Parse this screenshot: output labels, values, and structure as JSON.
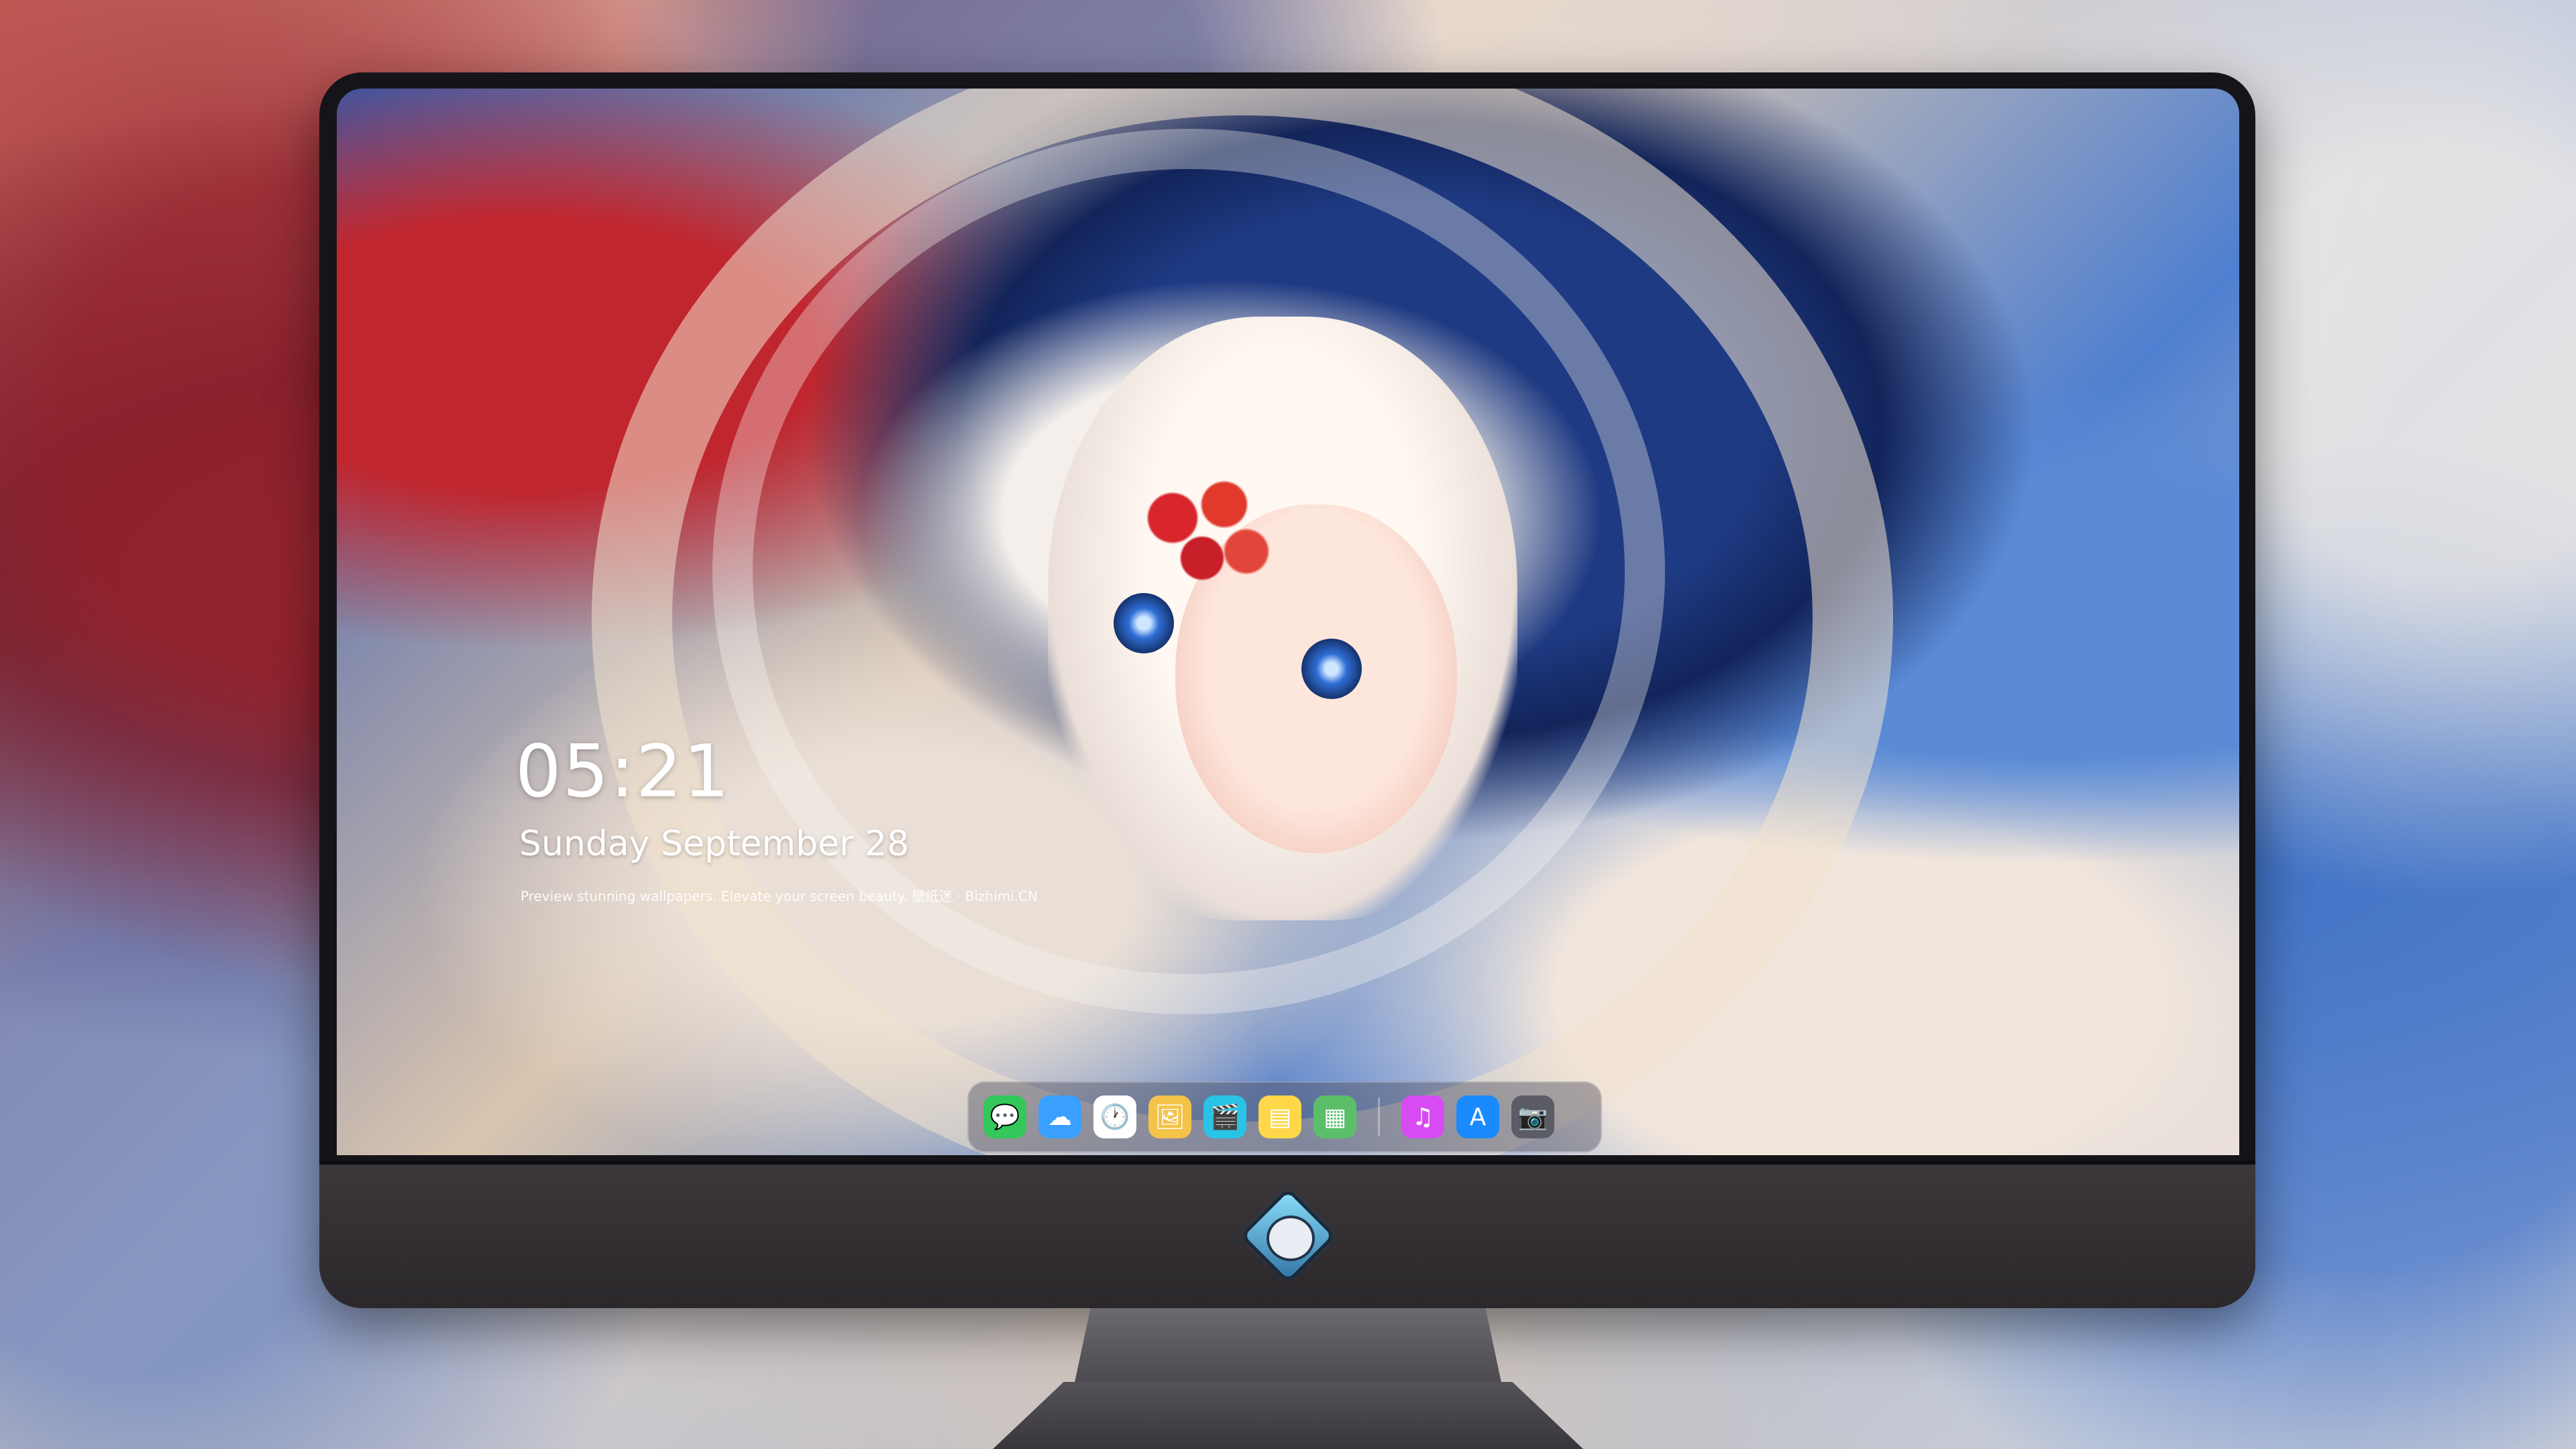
{
  "lock_screen": {
    "time": "05:21",
    "date": "Sunday September  28",
    "tagline": "Preview stunning wallpapers. Elevate your screen beauty. 壁纸迷 · Bizhimi.CN"
  },
  "dock": {
    "apps": [
      {
        "name": "Messages",
        "icon": "messages-icon",
        "glyph": "💬",
        "color": "#34c759"
      },
      {
        "name": "Weather",
        "icon": "weather-icon",
        "glyph": "☁",
        "color": "#3aa0ff"
      },
      {
        "name": "Clock",
        "icon": "clock-icon",
        "glyph": "🕐",
        "color": "#ffffff"
      },
      {
        "name": "Preview",
        "icon": "preview-icon",
        "glyph": "🖼",
        "color": "#f3c34a"
      },
      {
        "name": "Clips",
        "icon": "clapperboard-icon",
        "glyph": "🎬",
        "color": "#29c3e6"
      },
      {
        "name": "Notes",
        "icon": "notes-icon",
        "glyph": "▤",
        "color": "#ffd84a"
      },
      {
        "name": "Photos",
        "icon": "photos-icon",
        "glyph": "▦",
        "color": "#5bbf6a"
      },
      {
        "name": "Music",
        "icon": "music-icon",
        "glyph": "♫",
        "color": "#d64cf2"
      },
      {
        "name": "App Store",
        "icon": "app-store-icon",
        "glyph": "A",
        "color": "#1a8bff"
      },
      {
        "name": "Camera",
        "icon": "camera-icon",
        "glyph": "📷",
        "color": "#5c5c66"
      }
    ]
  }
}
